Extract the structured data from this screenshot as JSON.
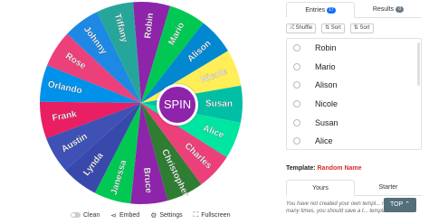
{
  "wheel": {
    "segments": [
      {
        "label": "Robin",
        "color": "#8e24aa"
      },
      {
        "label": "Mario",
        "color": "#00c853"
      },
      {
        "label": "Alison",
        "color": "#0288d1"
      },
      {
        "label": "Nicole",
        "color": "#ffee58"
      },
      {
        "label": "Susan",
        "color": "#00bfa5"
      },
      {
        "label": "Alice",
        "color": "#00e5a0"
      },
      {
        "label": "Charles",
        "color": "#ec407a"
      },
      {
        "label": "Christopher",
        "color": "#2e7d32"
      },
      {
        "label": "Bruce",
        "color": "#8e24aa"
      },
      {
        "label": "Janessa",
        "color": "#00c853"
      },
      {
        "label": "Lynda",
        "color": "#3949ab"
      },
      {
        "label": "Austin",
        "color": "#3f51b5"
      },
      {
        "label": "Frank",
        "color": "#e91e63"
      },
      {
        "label": "Orlando",
        "color": "#0091ea"
      },
      {
        "label": "Rose",
        "color": "#ec407a"
      },
      {
        "label": "Johnny",
        "color": "#1e88e5"
      },
      {
        "label": "Tiffany",
        "color": "#26a69a"
      }
    ],
    "spin_label": "SPIN"
  },
  "toolbar": {
    "clean": "Clean",
    "embed": "Embed",
    "settings": "Settings",
    "fullscreen": "Fullscreen"
  },
  "panel": {
    "tabs": {
      "entries_label": "Entries",
      "entries_count": "17",
      "results_label": "Results",
      "results_count": "0"
    },
    "actions": {
      "shuffle": "Shuffle",
      "sort_asc": "Sort",
      "sort_desc": "Sort"
    },
    "entries": [
      "Robin",
      "Mario",
      "Alison",
      "Nicole",
      "Susan",
      "Alice"
    ],
    "template_label": "Template:",
    "template_name": "Random Name",
    "sub_tabs": {
      "yours": "Yours",
      "starter": "Starter"
    },
    "help_text": "You have not created your own templ... reuse it many times, you should save a t... template.",
    "top_button": "TOP"
  }
}
